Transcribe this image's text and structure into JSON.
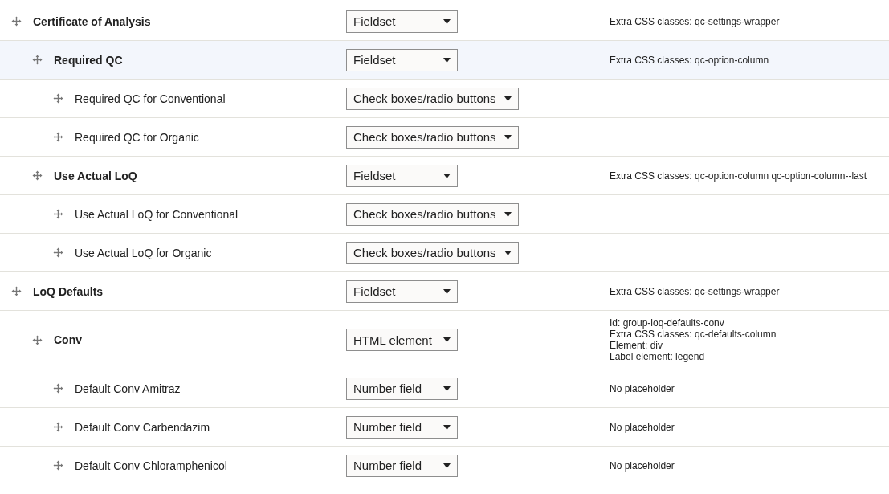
{
  "rows": [
    {
      "label": "Certificate of Analysis",
      "kind": "group",
      "selected": false,
      "widget": "Fieldset",
      "summary": [
        "Extra CSS classes: qc-settings-wrapper"
      ],
      "children": [
        {
          "label": "Required QC",
          "kind": "group",
          "selected": true,
          "widget": "Fieldset",
          "summary": [
            "Extra CSS classes: qc-option-column"
          ],
          "children": [
            {
              "label": "Required QC for Conventional",
              "kind": "field",
              "selected": false,
              "widget": "Check boxes/radio buttons"
            },
            {
              "label": "Required QC for Organic",
              "kind": "field",
              "selected": false,
              "widget": "Check boxes/radio buttons"
            }
          ]
        },
        {
          "label": "Use Actual LoQ",
          "kind": "group",
          "selected": false,
          "widget": "Fieldset",
          "summary": [
            "Extra CSS classes: qc-option-column qc-option-column--last"
          ],
          "children": [
            {
              "label": "Use Actual LoQ for Conventional",
              "kind": "field",
              "selected": false,
              "widget": "Check boxes/radio buttons"
            },
            {
              "label": "Use Actual LoQ for Organic",
              "kind": "field",
              "selected": false,
              "widget": "Check boxes/radio buttons"
            }
          ]
        }
      ]
    },
    {
      "label": "LoQ Defaults",
      "kind": "group",
      "selected": false,
      "widget": "Fieldset",
      "summary": [
        "Extra CSS classes: qc-settings-wrapper"
      ],
      "children": [
        {
          "label": "Conv",
          "kind": "group",
          "selected": false,
          "widget": "HTML element",
          "summary": [
            "Id: group-loq-defaults-conv",
            "Extra CSS classes: qc-defaults-column",
            "Element: div",
            "Label element: legend"
          ],
          "children": [
            {
              "label": "Default Conv Amitraz",
              "kind": "field",
              "selected": false,
              "widget": "Number field",
              "summary": [
                "No placeholder"
              ]
            },
            {
              "label": "Default Conv Carbendazim",
              "kind": "field",
              "selected": false,
              "widget": "Number field",
              "summary": [
                "No placeholder"
              ]
            },
            {
              "label": "Default Conv Chloramphenicol",
              "kind": "field",
              "selected": false,
              "widget": "Number field",
              "summary": [
                "No placeholder"
              ]
            }
          ]
        }
      ]
    }
  ]
}
